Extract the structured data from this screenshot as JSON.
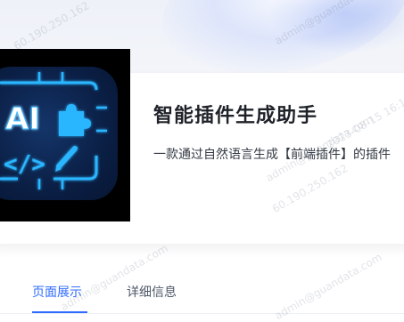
{
  "product": {
    "title": "智能插件生成助手",
    "description": "一款通过自然语言生成【前端插件】的插件"
  },
  "logo": {
    "text": "AI",
    "symbol": "</>",
    "icons": [
      "puzzle-icon",
      "pencil-icon"
    ]
  },
  "tabs": [
    {
      "label": "页面展示",
      "active": true
    },
    {
      "label": "详细信息",
      "active": false
    }
  ],
  "watermarks": [
    "admin@guandata.com",
    "60.190.250.162",
    "2023-08-15 16:15"
  ],
  "colors": {
    "accent": "#2f6bff",
    "logo_glow": "#29b6ff",
    "title": "#1f2329"
  }
}
